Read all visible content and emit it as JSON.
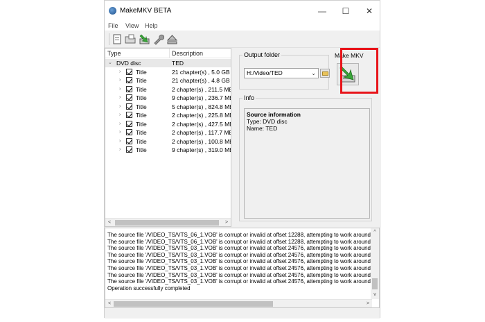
{
  "window": {
    "title": "MakeMKV BETA",
    "controls": {
      "minimize": "—",
      "maximize": "☐",
      "close": "✕"
    }
  },
  "menu": {
    "items": [
      "File",
      "View",
      "Help"
    ]
  },
  "toolbar": {
    "buttons": [
      "open-file-icon",
      "open-folder-icon",
      "save-mkv-icon",
      "settings-wrench-icon",
      "eject-icon"
    ]
  },
  "tree": {
    "columns": {
      "type": "Type",
      "description": "Description"
    },
    "root": {
      "type": "DVD disc",
      "description": "TED",
      "expander": "⌄"
    },
    "titles": [
      {
        "type": "Title",
        "description": "21 chapter(s) , 5.0 GB (l"
      },
      {
        "type": "Title",
        "description": "21 chapter(s) , 4.8 GB (l"
      },
      {
        "type": "Title",
        "description": "2 chapter(s) , 211.5 MB"
      },
      {
        "type": "Title",
        "description": "9 chapter(s) , 236.7 MB"
      },
      {
        "type": "Title",
        "description": "5 chapter(s) , 824.8 MB"
      },
      {
        "type": "Title",
        "description": "2 chapter(s) , 225.8 MB"
      },
      {
        "type": "Title",
        "description": "2 chapter(s) , 427.5 MB"
      },
      {
        "type": "Title",
        "description": "2 chapter(s) , 117.7 MB"
      },
      {
        "type": "Title",
        "description": "2 chapter(s) , 100.8 MB"
      },
      {
        "type": "Title",
        "description": "9 chapter(s) , 319.0 MB"
      }
    ],
    "expander_collapsed": "›"
  },
  "output": {
    "label": "Output folder",
    "value": "H:/Video/TED",
    "chevron": "⌄"
  },
  "make_mkv": {
    "label": "Make MKV"
  },
  "info": {
    "label": "Info",
    "heading": "Source information",
    "lines": [
      "Type: DVD disc",
      "Name: TED"
    ]
  },
  "log": {
    "lines": [
      "The source file '/VIDEO_TS/VTS_06_1.VOB' is corrupt or invalid at offset 12288, attempting to work around",
      "The source file '/VIDEO_TS/VTS_06_1.VOB' is corrupt or invalid at offset 12288, attempting to work around",
      "The source file '/VIDEO_TS/VTS_03_1.VOB' is corrupt or invalid at offset 24576, attempting to work around",
      "The source file '/VIDEO_TS/VTS_03_1.VOB' is corrupt or invalid at offset 24576, attempting to work around",
      "The source file '/VIDEO_TS/VTS_03_1.VOB' is corrupt or invalid at offset 24576, attempting to work around",
      "The source file '/VIDEO_TS/VTS_03_1.VOB' is corrupt or invalid at offset 24576, attempting to work around",
      "The source file '/VIDEO_TS/VTS_03_1.VOB' is corrupt or invalid at offset 24576, attempting to work around",
      "The source file '/VIDEO_TS/VTS_03_1.VOB' is corrupt or invalid at offset 24576, attempting to work around",
      "Operation successfully completed"
    ]
  },
  "scroll": {
    "left": "<",
    "right": ">",
    "up": "^",
    "down": "v"
  },
  "splitter_glyph": "⇔",
  "colors": {
    "highlight": "#e8141a",
    "make_arrow": "#3aa63a"
  }
}
